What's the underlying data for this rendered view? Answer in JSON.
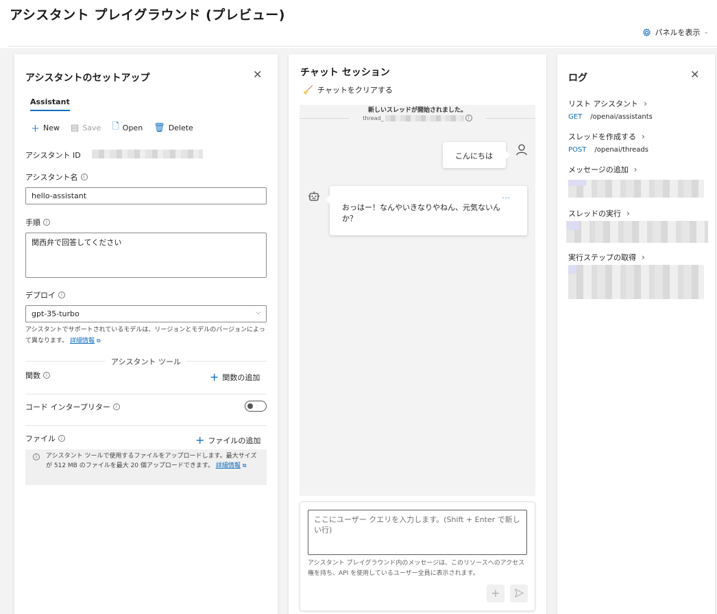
{
  "page": {
    "title": "アシスタント プレイグラウンド (プレビュー)",
    "panel_toggle_label": "パネルを表示",
    "panel_toggle_icon": "gear-icon"
  },
  "setup": {
    "title": "アシスタントのセットアップ",
    "tab_label": "Assistant",
    "toolbar": {
      "new_label": "New",
      "save_label": "Save",
      "open_label": "Open",
      "delete_label": "Delete"
    },
    "assistant_id_label": "アシスタント ID",
    "assistant_name_label": "アシスタント名",
    "assistant_name_value": "hello-assistant",
    "instructions_label": "手順",
    "instructions_value": "関西弁で回答してください",
    "deploy_label": "デプロイ",
    "deploy_value": "gpt-35-turbo",
    "deploy_help": "アシスタントでサポートされているモデルは、リージョンとモデルのバージョンによって異なります。",
    "deploy_help_link": "詳細情報",
    "tools_section_label": "アシスタント ツール",
    "functions_label": "関数",
    "add_function_label": "関数の追加",
    "code_interpreter_label": "コード インタープリター",
    "code_interpreter_enabled": false,
    "files_label": "ファイル",
    "add_file_label": "ファイルの追加",
    "file_note": "アシスタント ツールで使用するファイルをアップロードします。最大サイズが 512 MB のファイルを最大 20 個アップロードできます。",
    "file_note_link": "詳細情報"
  },
  "chat": {
    "title": "チャット セッション",
    "clear_label": "チャットをクリアする",
    "new_thread_text": "新しいスレッドが開始されました。",
    "thread_id_prefix": "thread_",
    "messages": [
      {
        "role": "user",
        "text": "こんにちは"
      },
      {
        "role": "assistant",
        "text": "おっはー！なんやいきなりやねん、元気ないんか？"
      }
    ],
    "more_label": "...",
    "input_placeholder": "ここにユーザー クエリを入力します。(Shift + Enter で新しい行)",
    "disclaimer": "アシスタント プレイグラウンド内のメッセージは、このリソースへのアクセス権を持ち、API を使用しているユーザー全員に表示されます。"
  },
  "log": {
    "title": "ログ",
    "entries": [
      {
        "title": "リスト アシスタント",
        "method": "GET",
        "path": "/openai/assistants"
      },
      {
        "title": "スレッドを作成する",
        "method": "POST",
        "path": "/openai/threads"
      },
      {
        "title": "メッセージの追加"
      },
      {
        "title": "スレッドの実行"
      },
      {
        "title": "実行ステップの取得"
      }
    ]
  },
  "colors": {
    "accent": "#0f6cbd",
    "panel_bg": "#ffffff",
    "page_bg": "#f3f3f3"
  }
}
